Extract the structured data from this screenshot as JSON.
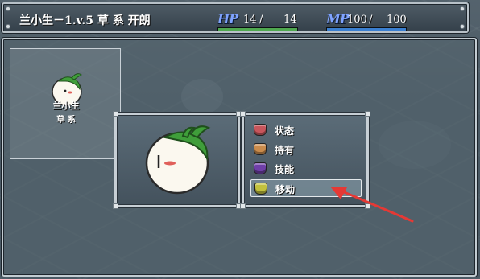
{
  "status": {
    "title": "兰小生－1.v.5 草 系 开朗",
    "hp": {
      "label": "HP",
      "current": "14",
      "max": "14",
      "fill": 1.0,
      "color": "#4fa84f"
    },
    "mp": {
      "label": "MP",
      "current": "100",
      "max": "100",
      "fill": 1.0,
      "color": "#3a7fd0"
    }
  },
  "party": {
    "name": "兰小生",
    "type": "草 系"
  },
  "menu": {
    "items": [
      {
        "label": "状态",
        "icon": "potion-red-icon",
        "color": "#c7565c"
      },
      {
        "label": "持有",
        "icon": "potion-orange-icon",
        "color": "#c98b4c"
      },
      {
        "label": "技能",
        "icon": "potion-purple-icon",
        "color": "#6f3fa8"
      },
      {
        "label": "移动",
        "icon": "potion-yellow-icon",
        "color": "#c2c13d",
        "selected": true
      }
    ]
  },
  "colors": {
    "accent_arrow": "#e53935",
    "sprite_leaf": "#3f9e3a",
    "sprite_body": "#fbf8ef"
  }
}
